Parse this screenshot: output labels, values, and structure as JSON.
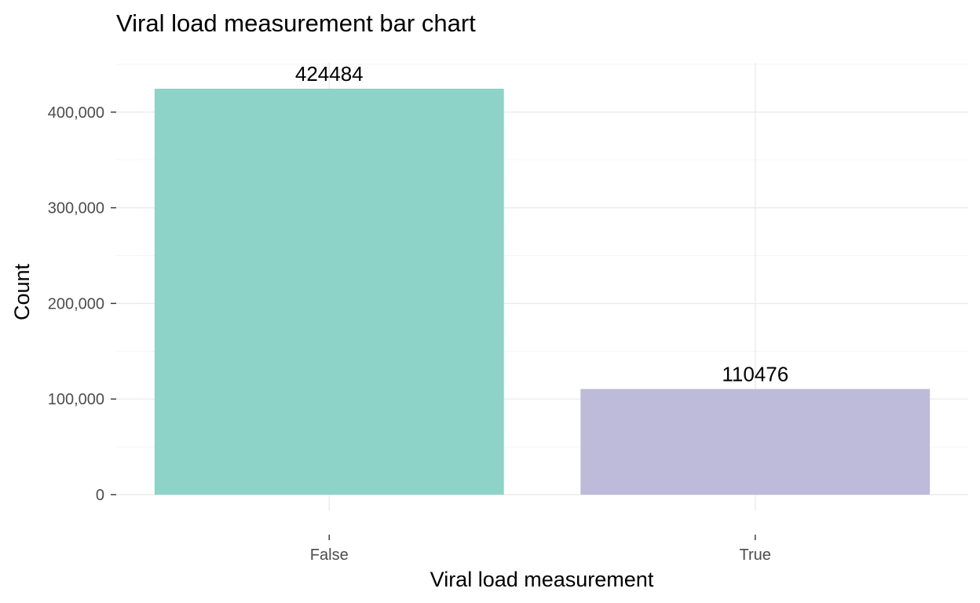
{
  "chart_data": {
    "type": "bar",
    "title": "Viral load measurement bar chart",
    "xlabel": "Viral load measurement",
    "ylabel": "Count",
    "categories": [
      "False",
      "True"
    ],
    "values": [
      424484,
      110476
    ],
    "data_labels": [
      "424484",
      "110476"
    ],
    "colors": [
      "#8ed3c7",
      "#bebada"
    ],
    "ylim": [
      0,
      460000
    ],
    "yticks": [
      0,
      100000,
      200000,
      300000,
      400000
    ],
    "ytick_labels": [
      "0",
      "100,000",
      "200,000",
      "300,000",
      "400,000"
    ],
    "grid": true,
    "legend": "none"
  }
}
